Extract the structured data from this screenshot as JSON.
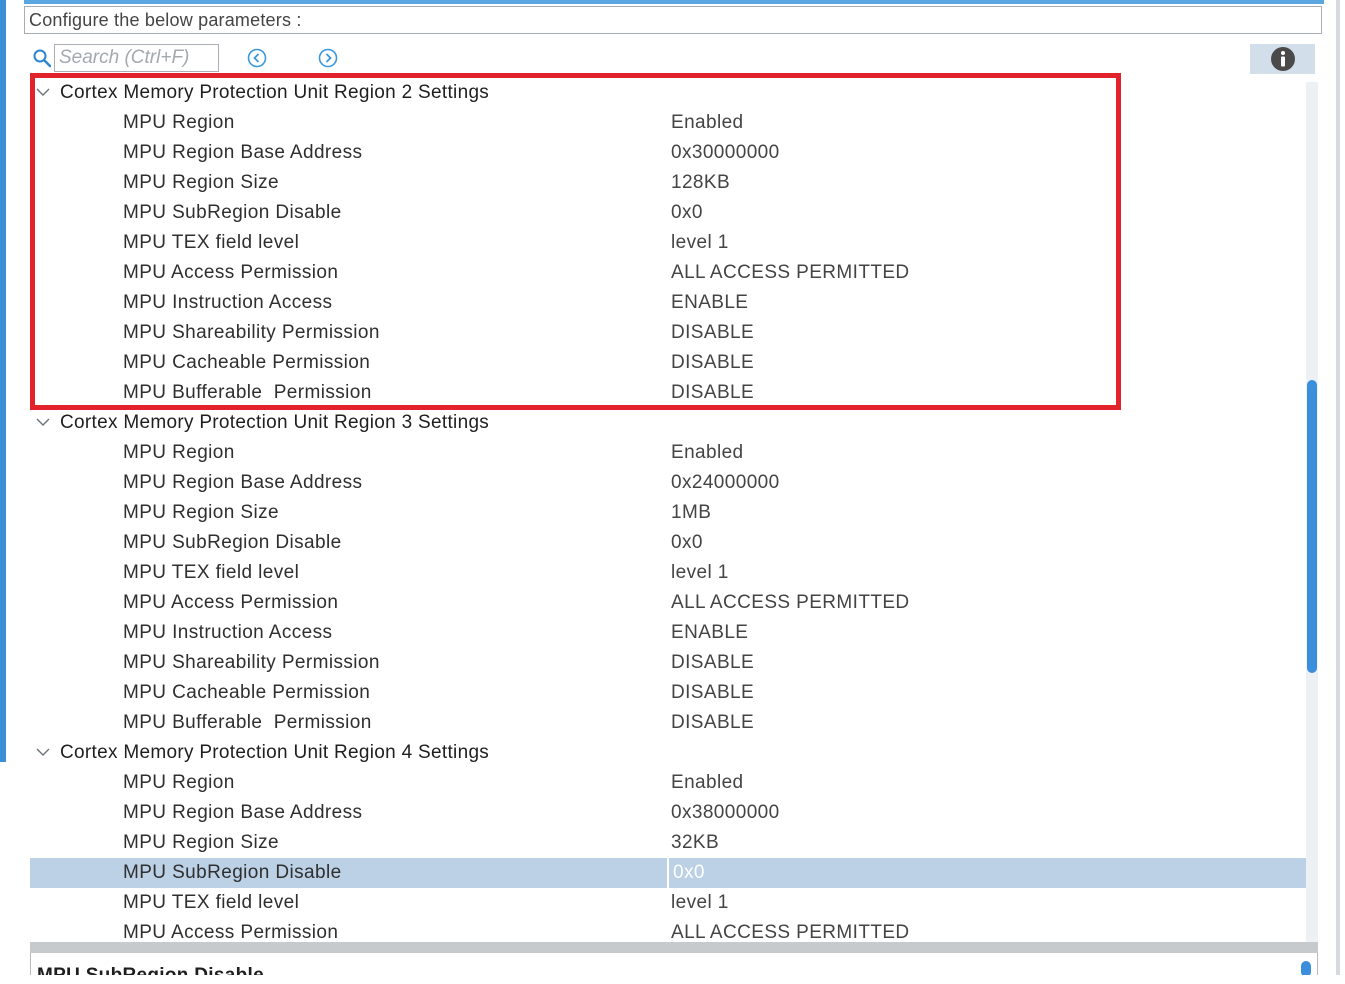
{
  "header": {
    "configure_label": "Configure the below parameters :"
  },
  "search": {
    "placeholder": "Search (Ctrl+F)"
  },
  "colors": {
    "highlight": "#e3232b",
    "selected_row": "#bcd0e6",
    "accent": "#3a8edc"
  },
  "groups": [
    {
      "title": "Cortex Memory Protection Unit Region 2 Settings",
      "params": [
        {
          "name": "MPU Region",
          "value": "Enabled"
        },
        {
          "name": "MPU Region Base Address",
          "value": "0x30000000"
        },
        {
          "name": "MPU Region Size",
          "value": "128KB"
        },
        {
          "name": "MPU SubRegion Disable",
          "value": "0x0"
        },
        {
          "name": "MPU TEX field level",
          "value": "level 1"
        },
        {
          "name": "MPU Access Permission",
          "value": "ALL ACCESS PERMITTED"
        },
        {
          "name": "MPU Instruction Access",
          "value": "ENABLE"
        },
        {
          "name": "MPU Shareability Permission",
          "value": "DISABLE"
        },
        {
          "name": "MPU Cacheable Permission",
          "value": "DISABLE"
        },
        {
          "name": "MPU Bufferable  Permission",
          "value": "DISABLE"
        }
      ]
    },
    {
      "title": "Cortex Memory Protection Unit Region 3 Settings",
      "params": [
        {
          "name": "MPU Region",
          "value": "Enabled"
        },
        {
          "name": "MPU Region Base Address",
          "value": "0x24000000"
        },
        {
          "name": "MPU Region Size",
          "value": "1MB"
        },
        {
          "name": "MPU SubRegion Disable",
          "value": "0x0"
        },
        {
          "name": "MPU TEX field level",
          "value": "level 1"
        },
        {
          "name": "MPU Access Permission",
          "value": "ALL ACCESS PERMITTED"
        },
        {
          "name": "MPU Instruction Access",
          "value": "ENABLE"
        },
        {
          "name": "MPU Shareability Permission",
          "value": "DISABLE"
        },
        {
          "name": "MPU Cacheable Permission",
          "value": "DISABLE"
        },
        {
          "name": "MPU Bufferable  Permission",
          "value": "DISABLE"
        }
      ]
    },
    {
      "title": "Cortex Memory Protection Unit Region 4 Settings",
      "params": [
        {
          "name": "MPU Region",
          "value": "Enabled"
        },
        {
          "name": "MPU Region Base Address",
          "value": "0x38000000"
        },
        {
          "name": "MPU Region Size",
          "value": "32KB"
        },
        {
          "name": "MPU SubRegion Disable",
          "value": "0x0",
          "selected": true
        },
        {
          "name": "MPU TEX field level",
          "value": "level 1"
        },
        {
          "name": "MPU Access Permission",
          "value": "ALL ACCESS PERMITTED"
        }
      ]
    }
  ],
  "description": {
    "title": "MPU SubRegion Disable"
  }
}
